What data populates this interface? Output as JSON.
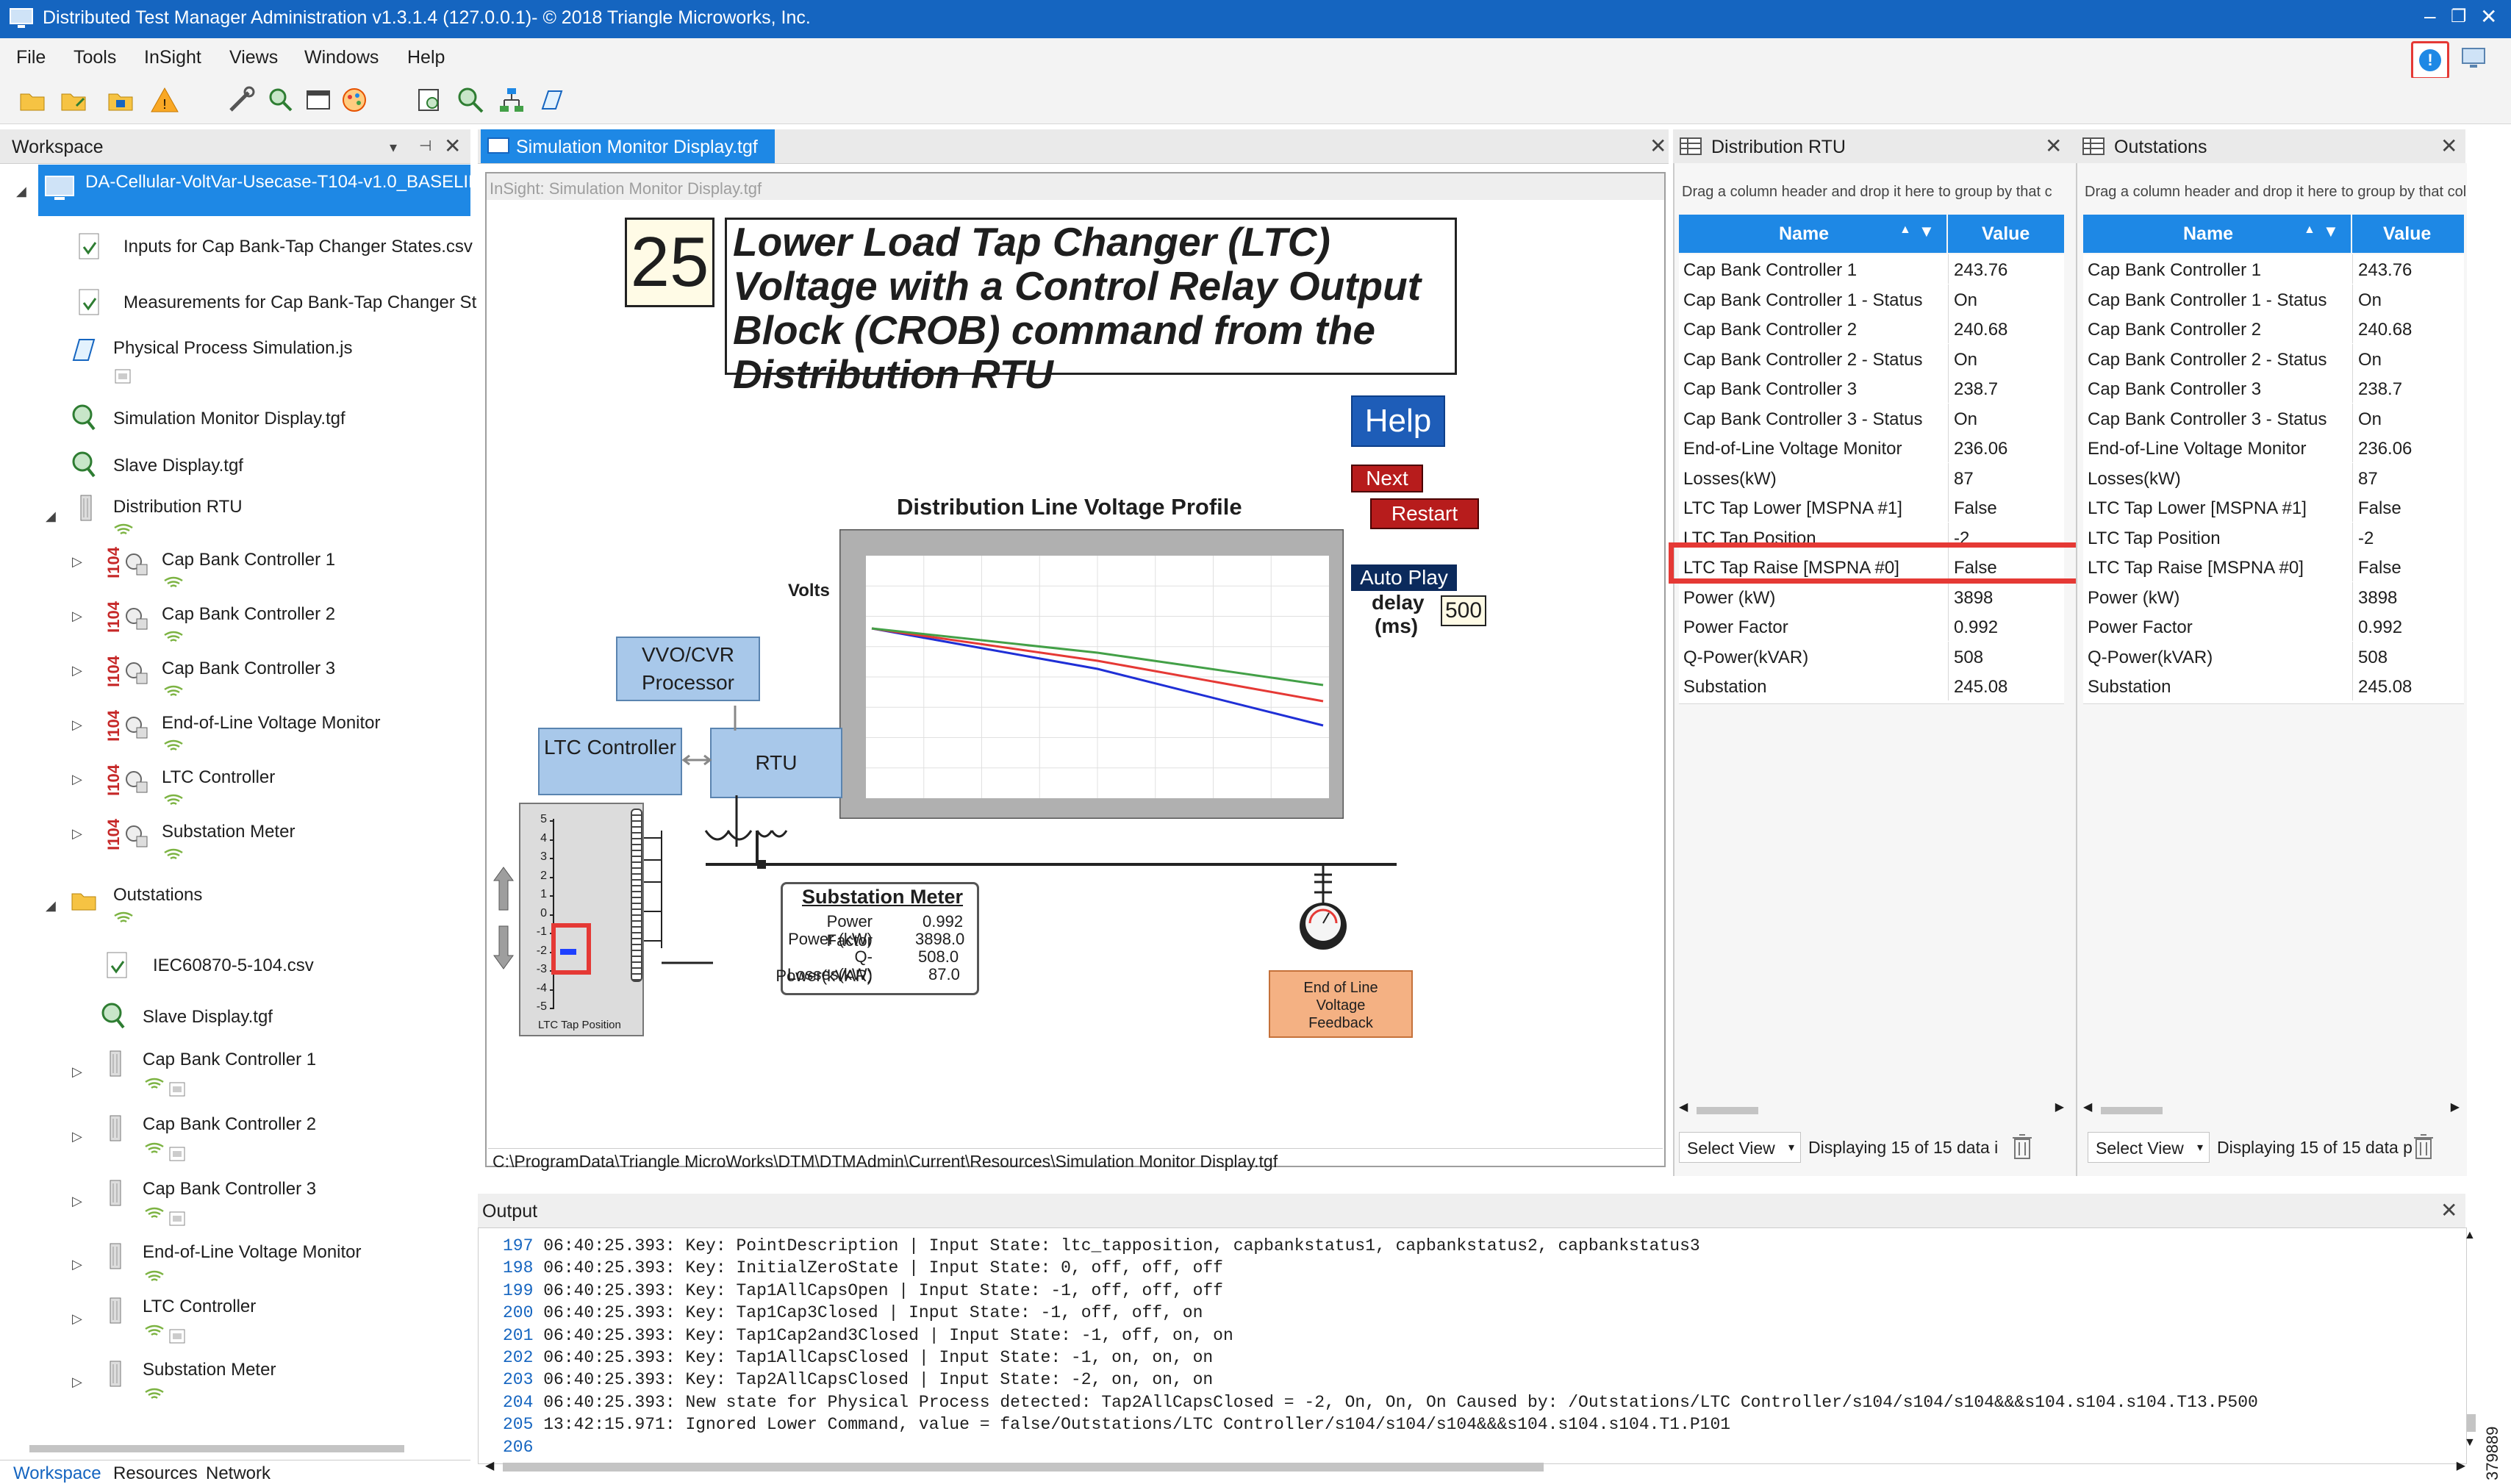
{
  "window": {
    "title": "Distributed Test Manager Administration v1.3.1.4 (127.0.0.1)- © 2018 Triangle Microworks, Inc.",
    "accent": "#1565c0"
  },
  "menu": [
    "File",
    "Tools",
    "InSight",
    "Views",
    "Windows",
    "Help"
  ],
  "workspace": {
    "title": "Workspace",
    "root": "DA-Cellular-VoltVar-Usecase-T104-v1.0_BASELINE",
    "items": [
      "Inputs for Cap Bank-Tap Changer States.csv",
      "Measurements for Cap Bank-Tap Changer St",
      "Physical Process Simulation.js",
      "Simulation Monitor Display.tgf",
      "Slave Display.tgf",
      "Distribution RTU"
    ],
    "rtu_children": [
      "Cap Bank Controller 1",
      "Cap Bank Controller 2",
      "Cap Bank Controller 3",
      "End-of-Line Voltage Monitor",
      "LTC Controller",
      "Substation Meter"
    ],
    "i104_label": "I104",
    "outstations": "Outstations",
    "out_items": [
      "IEC60870-5-104.csv",
      "Slave Display.tgf"
    ],
    "out_children": [
      "Cap Bank Controller 1",
      "Cap Bank Controller 2",
      "Cap Bank Controller 3",
      "End-of-Line Voltage Monitor",
      "LTC Controller",
      "Substation Meter"
    ],
    "bottom_tabs": [
      "Workspace",
      "Resources",
      "Network"
    ]
  },
  "sim": {
    "tab": "Simulation Monitor Display.tgf",
    "insight_label": "InSight: Simulation Monitor Display.tgf",
    "step": "25",
    "heading": "Lower Load Tap Changer (LTC) Voltage with a Control Relay Output Block (CROB) command from the Distribution RTU",
    "help": "Help",
    "next": "Next",
    "restart": "Restart",
    "autoplay": "Auto Play",
    "delay": "delay",
    "delay_unit": "(ms)",
    "delay_value": "500",
    "chart_title": "Distribution Line Voltage Profile",
    "volts": "Volts",
    "vvo": "VVO/CVR Processor",
    "ltc": "LTC Controller",
    "rtu": "RTU",
    "substation_meter": {
      "title": "Substation Meter",
      "rows": [
        {
          "label": "Power Factor",
          "value": "0.992"
        },
        {
          "label": "Power (kW)",
          "value": "3898.0"
        },
        {
          "label": "Q-Power(kVAR)",
          "value": "508.0"
        },
        {
          "label": "Losses(kW)",
          "value": "87.0"
        }
      ]
    },
    "eol": "End of Line Voltage Feedback",
    "tap_scale": [
      "5",
      "4",
      "3",
      "2",
      "1",
      "0",
      "-1",
      "-2",
      "-3",
      "-4",
      "-5"
    ],
    "tap_label": "LTC Tap Position",
    "path": "C:\\ProgramData\\Triangle MicroWorks\\DTM\\DTMAdmin\\Current\\Resources\\Simulation Monitor Display.tgf"
  },
  "chart_data": {
    "type": "line",
    "title": "Distribution Line Voltage Profile",
    "ylabel": "Volts",
    "x": [
      0,
      0.5,
      1
    ],
    "series": [
      {
        "values": [
          247,
          242,
          235
        ]
      },
      {
        "values": [
          247,
          243,
          238
        ]
      },
      {
        "values": [
          247,
          244,
          240
        ]
      }
    ],
    "colors": [
      "#1f2fd6",
      "#e53935",
      "#43a047"
    ]
  },
  "grid_rows": [
    {
      "name": "Cap Bank Controller 1",
      "value": "243.76"
    },
    {
      "name": "Cap Bank Controller 1 - Status",
      "value": "On"
    },
    {
      "name": "Cap Bank Controller 2",
      "value": "240.68"
    },
    {
      "name": "Cap Bank Controller 2 - Status",
      "value": "On"
    },
    {
      "name": "Cap Bank Controller 3",
      "value": "238.7"
    },
    {
      "name": "Cap Bank Controller 3 - Status",
      "value": "On"
    },
    {
      "name": "End-of-Line Voltage Monitor",
      "value": "236.06"
    },
    {
      "name": "Losses(kW)",
      "value": "87"
    },
    {
      "name": "LTC Tap Lower [MSPNA #1]",
      "value": "False"
    },
    {
      "name": "LTC Tap Position",
      "value": "-2"
    },
    {
      "name": "LTC Tap Raise [MSPNA #0]",
      "value": "False"
    },
    {
      "name": "Power (kW)",
      "value": "3898"
    },
    {
      "name": "Power Factor",
      "value": "0.992"
    },
    {
      "name": "Q-Power(kVAR)",
      "value": "508"
    },
    {
      "name": "Substation",
      "value": "245.08"
    }
  ],
  "rtu_panel": {
    "title": "Distribution RTU",
    "hint": "Drag a column header and drop it here to group by that c",
    "col_name": "Name",
    "col_value": "Value",
    "select_view": "Select View",
    "displaying": "Displaying 15 of 15 data i"
  },
  "out_panel": {
    "title": "Outstations",
    "hint": "Drag a column header and drop it here to group by that col",
    "col_name": "Name",
    "col_value": "Value",
    "select_view": "Select View",
    "displaying": "Displaying 15 of 15 data p"
  },
  "output": {
    "title": "Output",
    "lines": [
      {
        "n": "197",
        "t": "06:40:25.393: Key: PointDescription | Input State: ltc_tapposition, capbankstatus1, capbankstatus2, capbankstatus3"
      },
      {
        "n": "198",
        "t": "06:40:25.393: Key: InitialZeroState | Input State: 0, off, off, off"
      },
      {
        "n": "199",
        "t": "06:40:25.393: Key: Tap1AllCapsOpen | Input State: -1, off, off, off"
      },
      {
        "n": "200",
        "t": "06:40:25.393: Key: Tap1Cap3Closed | Input State: -1, off, off, on"
      },
      {
        "n": "201",
        "t": "06:40:25.393: Key: Tap1Cap2and3Closed | Input State: -1, off, on, on"
      },
      {
        "n": "202",
        "t": "06:40:25.393: Key: Tap1AllCapsClosed | Input State: -1, on, on, on"
      },
      {
        "n": "203",
        "t": "06:40:25.393: Key: Tap2AllCapsClosed | Input State: -2, on, on, on"
      },
      {
        "n": "204",
        "t": "06:40:25.393: New state for Physical Process detected: Tap2AllCapsClosed = -2, On, On, On Caused by: /Outstations/LTC Controller/s104/s104/s104&&&s104.s104.s104.T13.P500"
      },
      {
        "n": "205",
        "t": "13:42:15.971: Ignored Lower Command, value = false/Outstations/LTC Controller/s104/s104/s104&&&s104.s104.s104.T1.P101"
      },
      {
        "n": "206",
        "t": ""
      }
    ]
  },
  "figure_id": "379889"
}
